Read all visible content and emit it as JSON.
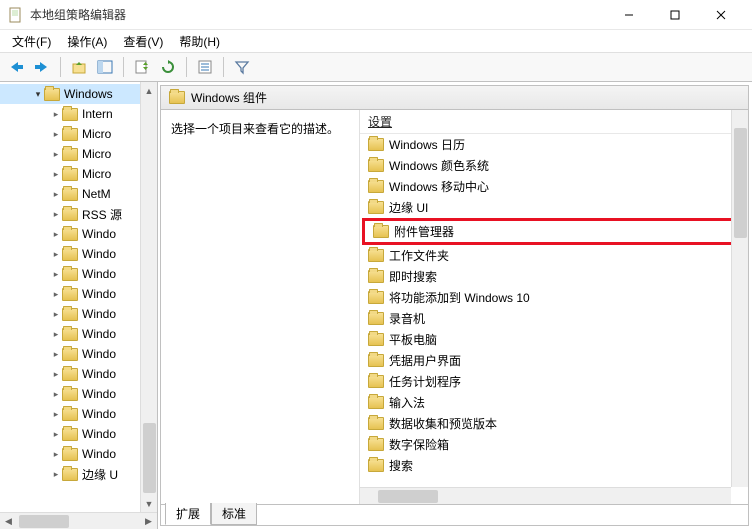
{
  "window": {
    "title": "本地组策略编辑器"
  },
  "menu": {
    "file": "文件(F)",
    "action": "操作(A)",
    "view": "查看(V)",
    "help": "帮助(H)"
  },
  "tree": {
    "root": "Windows",
    "children": [
      "Intern",
      "Micro",
      "Micro",
      "Micro",
      "NetM",
      "RSS 源",
      "Windo",
      "Windo",
      "Windo",
      "Windo",
      "Windo",
      "Windo",
      "Windo",
      "Windo",
      "Windo",
      "Windo",
      "Windo",
      "Windo",
      "边缘 U"
    ]
  },
  "header": {
    "title": "Windows 组件"
  },
  "desc": {
    "text": "选择一个项目来查看它的描述。"
  },
  "settings_header": "设置",
  "settings": [
    "Windows 日历",
    "Windows 颜色系统",
    "Windows 移动中心",
    "边缘 UI",
    "附件管理器",
    "工作文件夹",
    "即时搜索",
    "将功能添加到 Windows 10",
    "录音机",
    "平板电脑",
    "凭据用户界面",
    "任务计划程序",
    "输入法",
    "数据收集和预览版本",
    "数字保险箱",
    "搜索"
  ],
  "highlight_index": 4,
  "tabs": {
    "extended": "扩展",
    "standard": "标准"
  }
}
